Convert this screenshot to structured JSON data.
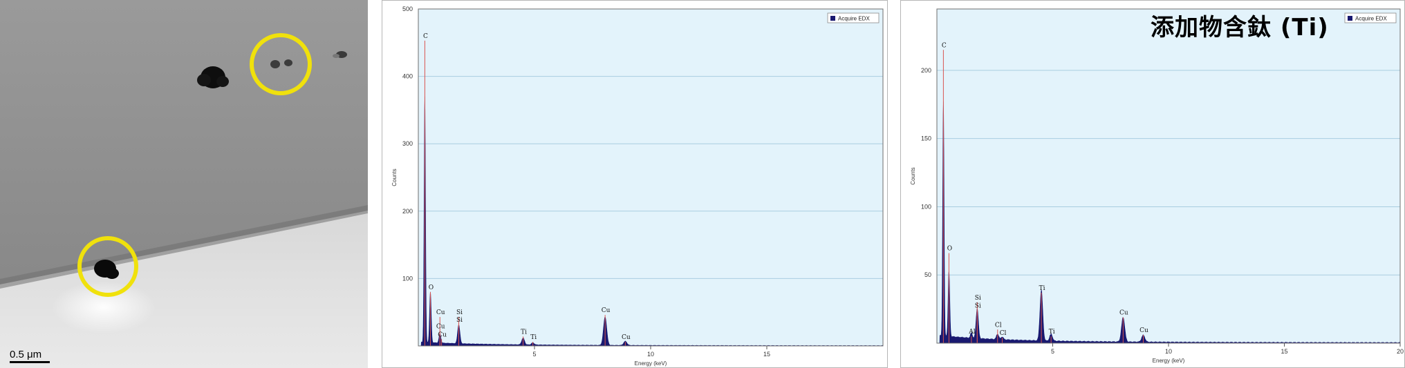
{
  "micrograph": {
    "scale_bar_label": "0.5 μm"
  },
  "overlay_title": "添加物含鈦 (Ti)",
  "chart_data": [
    {
      "type": "line",
      "title": "",
      "xlabel": "Energy (keV)",
      "ylabel": "Counts",
      "xlim": [
        0,
        20
      ],
      "ylim": [
        0,
        500
      ],
      "x_ticks": [
        5,
        10,
        15
      ],
      "y_ticks": [
        100,
        200,
        300,
        400,
        500
      ],
      "grid": true,
      "legend": {
        "position": "top-right",
        "entries": [
          "Acquire EDX"
        ]
      },
      "colors": {
        "plot_bg": "#e3f3fb",
        "spectrum": "#191970",
        "marker": "#d9534f",
        "grid": "#a9cde0"
      },
      "series": [
        {
          "name": "Acquire EDX",
          "peaks": [
            {
              "x": 0.28,
              "y": 365,
              "w": 0.03
            },
            {
              "x": 0.52,
              "y": 75,
              "w": 0.035
            },
            {
              "x": 0.93,
              "y": 14,
              "w": 0.04
            },
            {
              "x": 1.74,
              "y": 28,
              "w": 0.05
            },
            {
              "x": 4.51,
              "y": 10,
              "w": 0.06
            },
            {
              "x": 4.93,
              "y": 3,
              "w": 0.06
            },
            {
              "x": 8.04,
              "y": 42,
              "w": 0.07
            },
            {
              "x": 8.91,
              "y": 6,
              "w": 0.07
            }
          ]
        }
      ],
      "markers": [
        {
          "label": "C",
          "x": 0.28,
          "y": 455
        },
        {
          "label": "O",
          "x": 0.52,
          "y": 82
        },
        {
          "label": "Cu",
          "x": 0.93,
          "y": 45
        },
        {
          "label": "Cu",
          "x": 0.93,
          "y": 24
        },
        {
          "label": "Cu",
          "x": 1.0,
          "y": 12
        },
        {
          "label": "Si",
          "x": 1.74,
          "y": 45
        },
        {
          "label": "Si",
          "x": 1.74,
          "y": 34
        },
        {
          "label": "Ti",
          "x": 4.51,
          "y": 16
        },
        {
          "label": "Ti",
          "x": 4.93,
          "y": 8
        },
        {
          "label": "Cu",
          "x": 8.04,
          "y": 48
        },
        {
          "label": "Cu",
          "x": 8.91,
          "y": 8
        }
      ]
    },
    {
      "type": "line",
      "title": "",
      "xlabel": "Energy (keV)",
      "ylabel": "Counts",
      "xlim": [
        0,
        20
      ],
      "ylim": [
        0,
        245
      ],
      "x_ticks": [
        5,
        10,
        15,
        20
      ],
      "y_ticks": [
        50,
        100,
        150,
        200
      ],
      "grid": true,
      "legend": {
        "position": "top-right",
        "entries": [
          "Acquire EDX"
        ]
      },
      "colors": {
        "plot_bg": "#e3f3fb",
        "spectrum": "#191970",
        "marker": "#d9534f",
        "grid": "#a9cde0"
      },
      "series": [
        {
          "name": "Acquire EDX",
          "peaks": [
            {
              "x": 0.28,
              "y": 172,
              "w": 0.03
            },
            {
              "x": 0.52,
              "y": 48,
              "w": 0.035
            },
            {
              "x": 1.49,
              "y": 4,
              "w": 0.04
            },
            {
              "x": 1.74,
              "y": 22,
              "w": 0.05
            },
            {
              "x": 2.62,
              "y": 4,
              "w": 0.05
            },
            {
              "x": 2.82,
              "y": 2,
              "w": 0.05
            },
            {
              "x": 4.51,
              "y": 37,
              "w": 0.06
            },
            {
              "x": 4.93,
              "y": 5,
              "w": 0.06
            },
            {
              "x": 8.04,
              "y": 18,
              "w": 0.07
            },
            {
              "x": 8.91,
              "y": 5,
              "w": 0.07
            }
          ]
        }
      ],
      "markers": [
        {
          "label": "C",
          "x": 0.28,
          "y": 216
        },
        {
          "label": "O",
          "x": 0.52,
          "y": 67
        },
        {
          "label": "Al",
          "x": 1.49,
          "y": 6
        },
        {
          "label": "Si",
          "x": 1.74,
          "y": 31
        },
        {
          "label": "Si",
          "x": 1.74,
          "y": 25
        },
        {
          "label": "Cl",
          "x": 2.62,
          "y": 11
        },
        {
          "label": "Cl",
          "x": 2.82,
          "y": 5
        },
        {
          "label": "Ti",
          "x": 4.51,
          "y": 38
        },
        {
          "label": "Ti",
          "x": 4.93,
          "y": 6
        },
        {
          "label": "Cu",
          "x": 8.04,
          "y": 20
        },
        {
          "label": "Cu",
          "x": 8.91,
          "y": 7
        }
      ]
    }
  ]
}
